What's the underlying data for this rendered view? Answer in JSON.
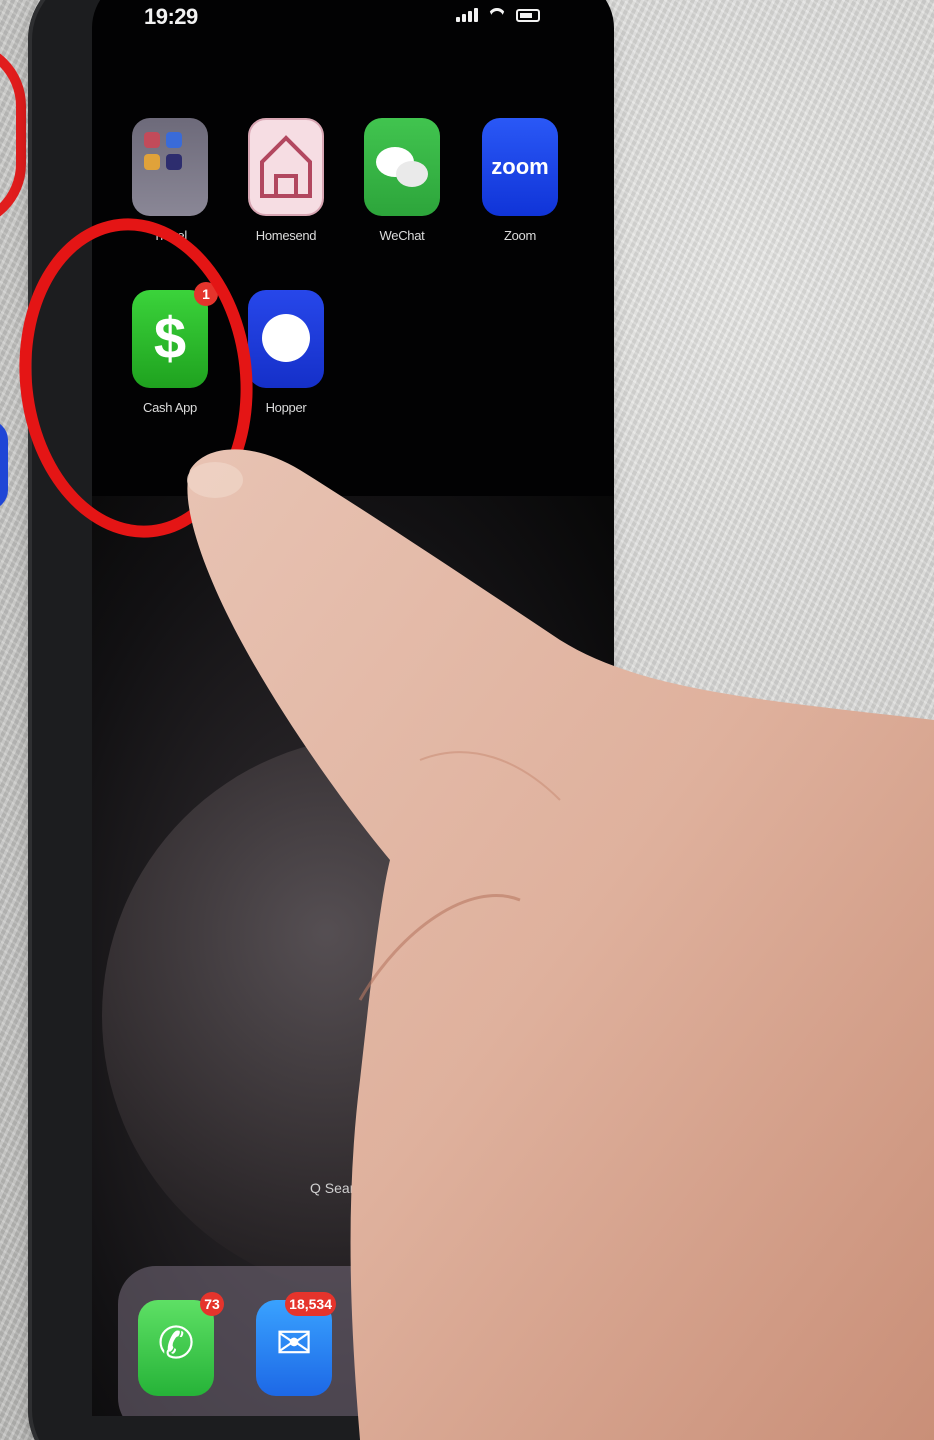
{
  "status_bar": {
    "time": "19:29"
  },
  "home_screen": {
    "apps": [
      {
        "id": "travel",
        "label": "Travel",
        "icon": "folder-icon"
      },
      {
        "id": "home",
        "label": "Homesend",
        "icon": "house-icon"
      },
      {
        "id": "wechat",
        "label": "WeChat",
        "icon": "wechat-icon"
      },
      {
        "id": "zoom",
        "label": "Zoom",
        "icon": "zoom-icon",
        "tile_text": "zoom"
      },
      {
        "id": "cash",
        "label": "Cash App",
        "icon": "dollar-icon",
        "tile_text": "$",
        "badge": "1"
      },
      {
        "id": "blue",
        "label": "Hopper",
        "icon": "circle-app-icon"
      }
    ],
    "search_label": "Q Search"
  },
  "dock": {
    "apps": [
      {
        "id": "phone",
        "icon": "phone-icon",
        "badge": "73"
      },
      {
        "id": "mail",
        "icon": "mail-icon",
        "badge": "18,534"
      },
      {
        "id": "safari",
        "icon": "safari-icon"
      }
    ]
  },
  "colors": {
    "highlight_circle": "#e41515",
    "cash_green": "#2fbf2f",
    "zoom_blue": "#1f46e8",
    "badge_red": "#e5342c"
  }
}
